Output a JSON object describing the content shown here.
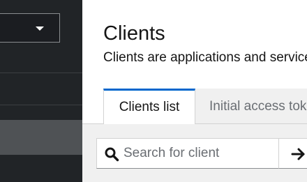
{
  "page": {
    "title": "Clients",
    "description": "Clients are applications and services that can request authentication of a user."
  },
  "tabs": [
    {
      "label": "Clients list",
      "active": true
    },
    {
      "label": "Initial access token",
      "active": false
    }
  ],
  "search": {
    "placeholder": "Search for client",
    "value": ""
  },
  "icons": {
    "realm_caret": "caret-down-icon",
    "search": "search-icon",
    "search_submit": "arrow-right-icon"
  },
  "colors": {
    "sidebar_bg": "#212427",
    "active_tab_border": "#0066cc",
    "nav_active_bg": "#4f5255"
  }
}
